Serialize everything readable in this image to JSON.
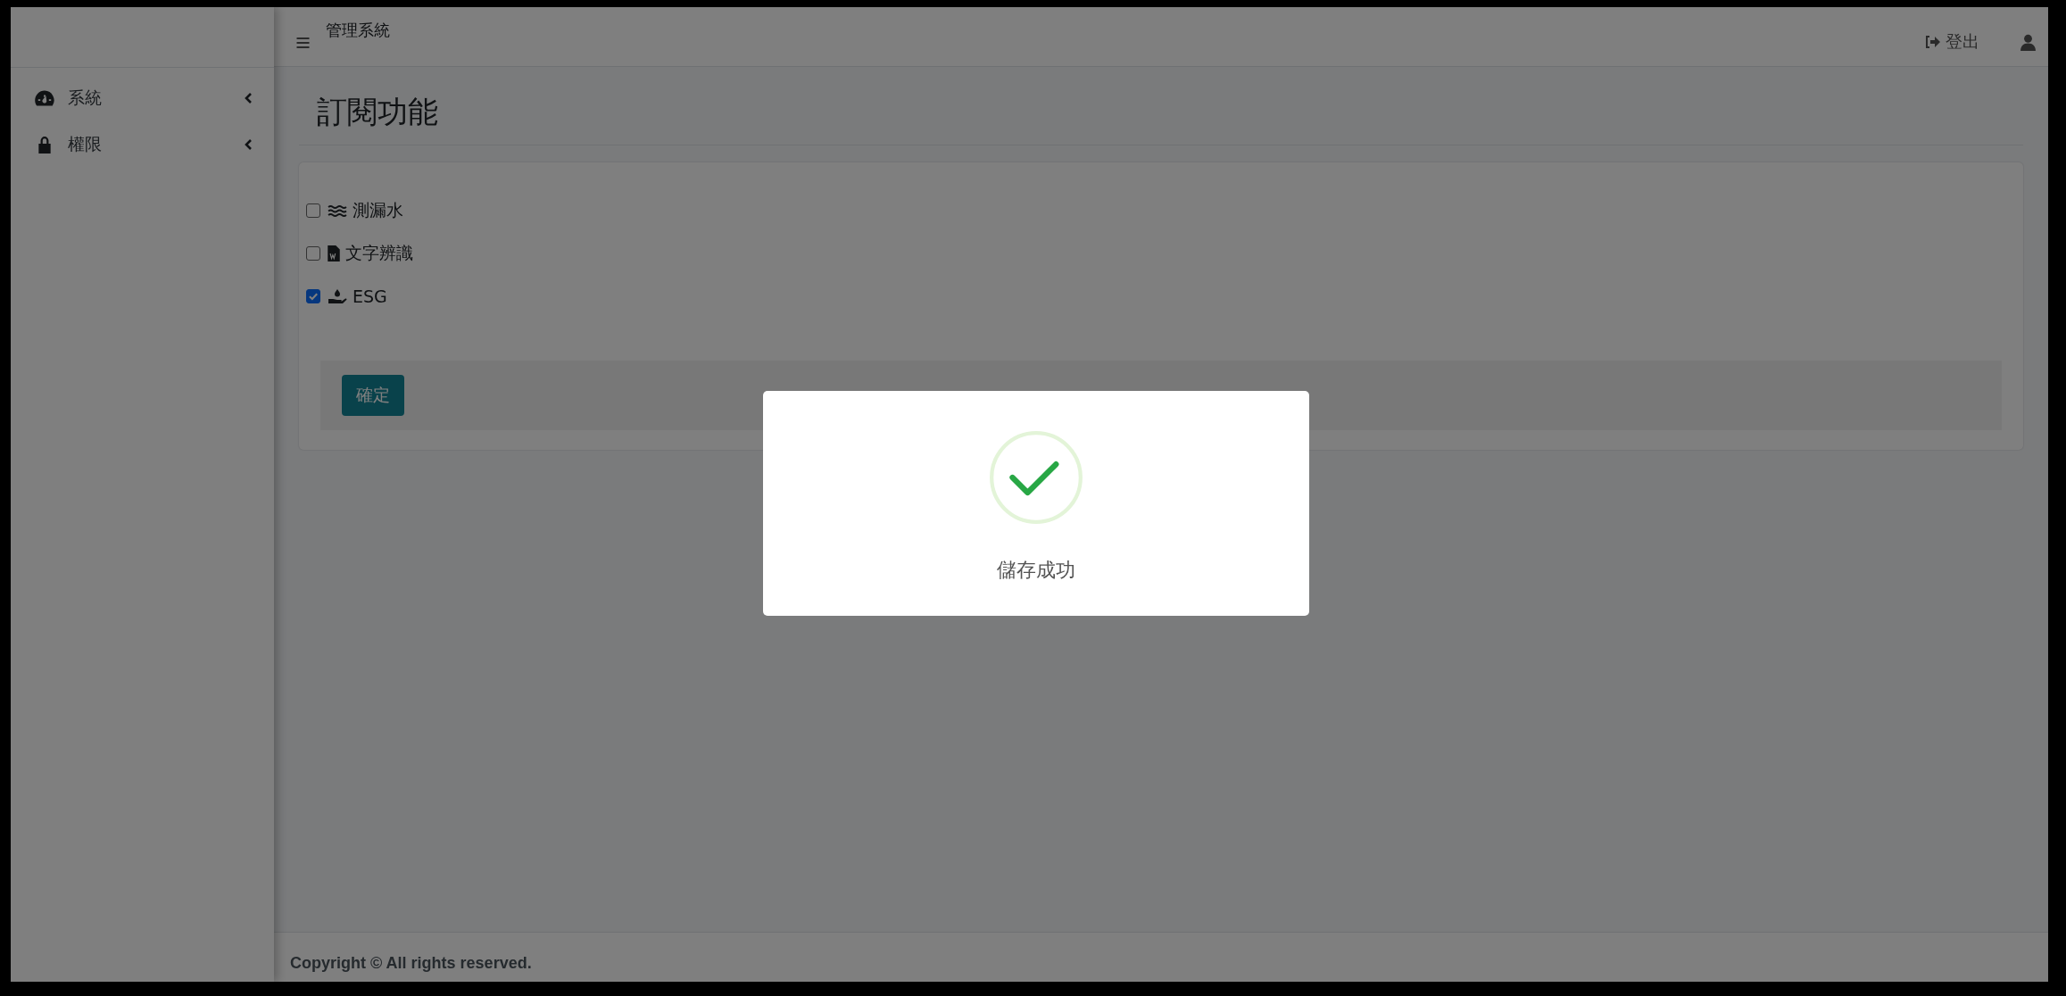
{
  "header": {
    "app_title": "管理系統",
    "logout": "登出"
  },
  "sidebar": {
    "items": [
      {
        "label": "系統",
        "expanded": false
      },
      {
        "label": "權限",
        "expanded": false
      }
    ]
  },
  "page": {
    "title": "訂閱功能"
  },
  "subscriptions": [
    {
      "label": "測漏水",
      "checked": false
    },
    {
      "label": "文字辨識",
      "checked": false
    },
    {
      "label": "ESG",
      "checked": true
    }
  ],
  "confirm_button": "確定",
  "dialog": {
    "message": "儲存成功"
  },
  "footer": "Copyright © All rights reserved."
}
